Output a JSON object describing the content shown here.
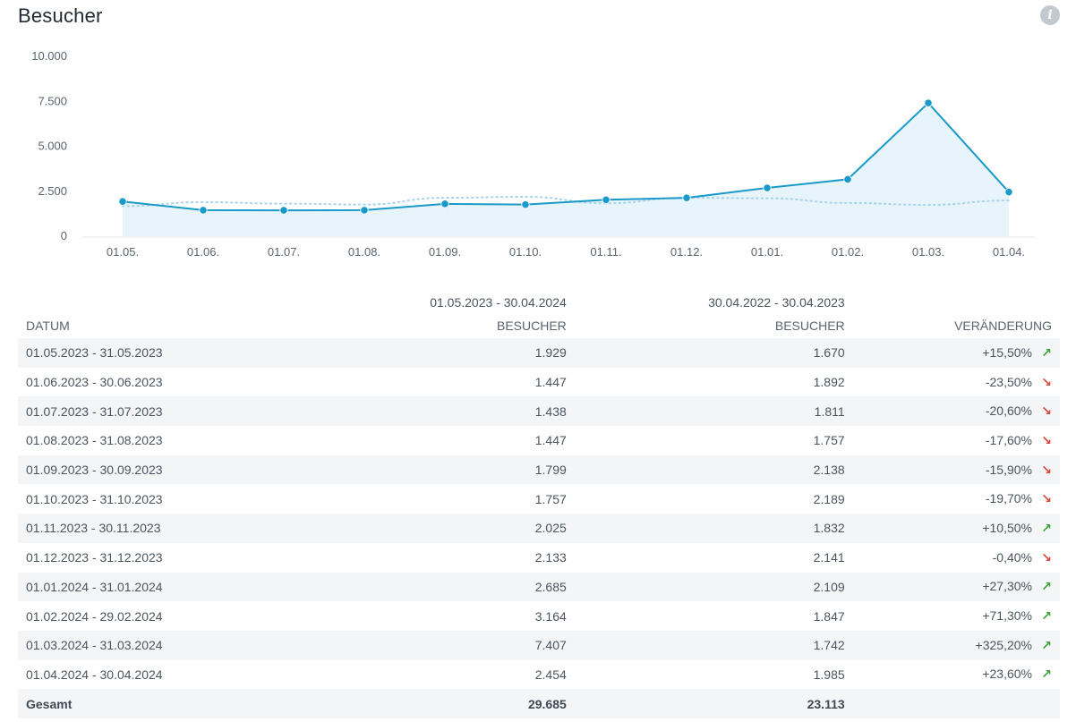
{
  "title": "Besucher",
  "info_icon": "info-icon",
  "colors": {
    "line": "#1a9ac9",
    "area": "#e6f3fb",
    "compare": "#a8d3ea",
    "up": "#3aa33a",
    "down": "#d9443b"
  },
  "chart_data": {
    "type": "line",
    "categories": [
      "01.05.",
      "01.06.",
      "01.07.",
      "01.08.",
      "01.09.",
      "01.10.",
      "01.11.",
      "01.12.",
      "01.01.",
      "01.02.",
      "01.03.",
      "01.04."
    ],
    "series": [
      {
        "values": [
          1929,
          1447,
          1438,
          1447,
          1799,
          1757,
          2025,
          2133,
          2685,
          3164,
          7407,
          2454
        ]
      },
      {
        "values": [
          1670,
          1892,
          1811,
          1757,
          2138,
          2189,
          1832,
          2141,
          2109,
          1847,
          1742,
          1985
        ]
      }
    ],
    "yticks": [
      "0",
      "2.500",
      "5.000",
      "7.500",
      "10.000"
    ],
    "ylim": [
      0,
      10000
    ],
    "grid": false
  },
  "table": {
    "period_current": "01.05.2023 - 30.04.2024",
    "period_previous": "30.04.2022 - 30.04.2023",
    "headers": {
      "date": "DATUM",
      "visitors_current": "BESUCHER",
      "visitors_previous": "BESUCHER",
      "change": "VERÄNDERUNG"
    },
    "rows": [
      {
        "date": "01.05.2023 - 31.05.2023",
        "current": "1.929",
        "previous": "1.670",
        "change": "+15,50%",
        "trend": "up"
      },
      {
        "date": "01.06.2023 - 30.06.2023",
        "current": "1.447",
        "previous": "1.892",
        "change": "-23,50%",
        "trend": "down"
      },
      {
        "date": "01.07.2023 - 31.07.2023",
        "current": "1.438",
        "previous": "1.811",
        "change": "-20,60%",
        "trend": "down"
      },
      {
        "date": "01.08.2023 - 31.08.2023",
        "current": "1.447",
        "previous": "1.757",
        "change": "-17,60%",
        "trend": "down"
      },
      {
        "date": "01.09.2023 - 30.09.2023",
        "current": "1.799",
        "previous": "2.138",
        "change": "-15,90%",
        "trend": "down"
      },
      {
        "date": "01.10.2023 - 31.10.2023",
        "current": "1.757",
        "previous": "2.189",
        "change": "-19,70%",
        "trend": "down"
      },
      {
        "date": "01.11.2023 - 30.11.2023",
        "current": "2.025",
        "previous": "1.832",
        "change": "+10,50%",
        "trend": "up"
      },
      {
        "date": "01.12.2023 - 31.12.2023",
        "current": "2.133",
        "previous": "2.141",
        "change": "-0,40%",
        "trend": "down"
      },
      {
        "date": "01.01.2024 - 31.01.2024",
        "current": "2.685",
        "previous": "2.109",
        "change": "+27,30%",
        "trend": "up"
      },
      {
        "date": "01.02.2024 - 29.02.2024",
        "current": "3.164",
        "previous": "1.847",
        "change": "+71,30%",
        "trend": "up"
      },
      {
        "date": "01.03.2024 - 31.03.2024",
        "current": "7.407",
        "previous": "1.742",
        "change": "+325,20%",
        "trend": "up"
      },
      {
        "date": "01.04.2024 - 30.04.2024",
        "current": "2.454",
        "previous": "1.985",
        "change": "+23,60%",
        "trend": "up"
      }
    ],
    "total": {
      "label": "Gesamt",
      "current": "29.685",
      "previous": "23.113"
    }
  }
}
